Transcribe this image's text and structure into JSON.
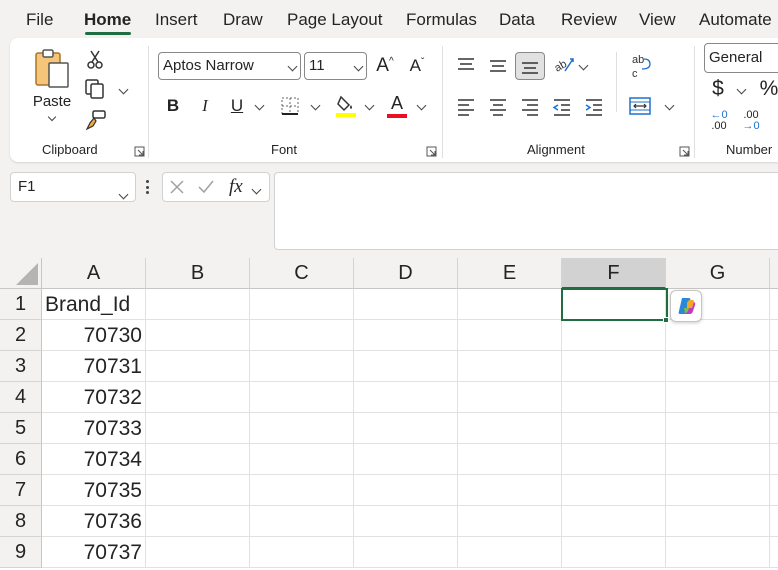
{
  "menu": {
    "tabs": [
      {
        "label": "File"
      },
      {
        "label": "Home"
      },
      {
        "label": "Insert"
      },
      {
        "label": "Draw"
      },
      {
        "label": "Page Layout"
      },
      {
        "label": "Formulas"
      },
      {
        "label": "Data"
      },
      {
        "label": "Review"
      },
      {
        "label": "View"
      },
      {
        "label": "Automate"
      }
    ],
    "active_tab": "Home"
  },
  "ribbon": {
    "clipboard": {
      "group_label": "Clipboard",
      "paste_label": "Paste"
    },
    "font": {
      "group_label": "Font",
      "font_name": "Aptos Narrow",
      "font_size": "11",
      "bold_label": "B",
      "italic_label": "I",
      "underline_label": "U",
      "font_color_letter": "A",
      "grow_font": "A",
      "shrink_font": "A",
      "fill_color": "#ffff00",
      "font_color": "#e81123"
    },
    "alignment": {
      "group_label": "Alignment"
    },
    "number": {
      "group_label": "Number",
      "format": "General",
      "currency_symbol": "$",
      "percent_symbol": "%",
      "increase_decimal_top": "←0",
      "increase_decimal_bottom": ".00",
      "decrease_decimal_top": ".00",
      "decrease_decimal_bottom": "→0"
    }
  },
  "formula_bar": {
    "name_box": "F1",
    "fx_label": "fx",
    "content": ""
  },
  "sheet": {
    "columns": [
      "A",
      "B",
      "C",
      "D",
      "E",
      "F",
      "G"
    ],
    "selected_column": "F",
    "rows": [
      "1",
      "2",
      "3",
      "4",
      "5",
      "6",
      "7",
      "8",
      "9"
    ],
    "column_a": [
      "Brand_Id",
      "70730",
      "70731",
      "70732",
      "70733",
      "70734",
      "70735",
      "70736",
      "70737"
    ],
    "selected_cell": "F1"
  },
  "colors": {
    "accent": "#1e6e42"
  }
}
